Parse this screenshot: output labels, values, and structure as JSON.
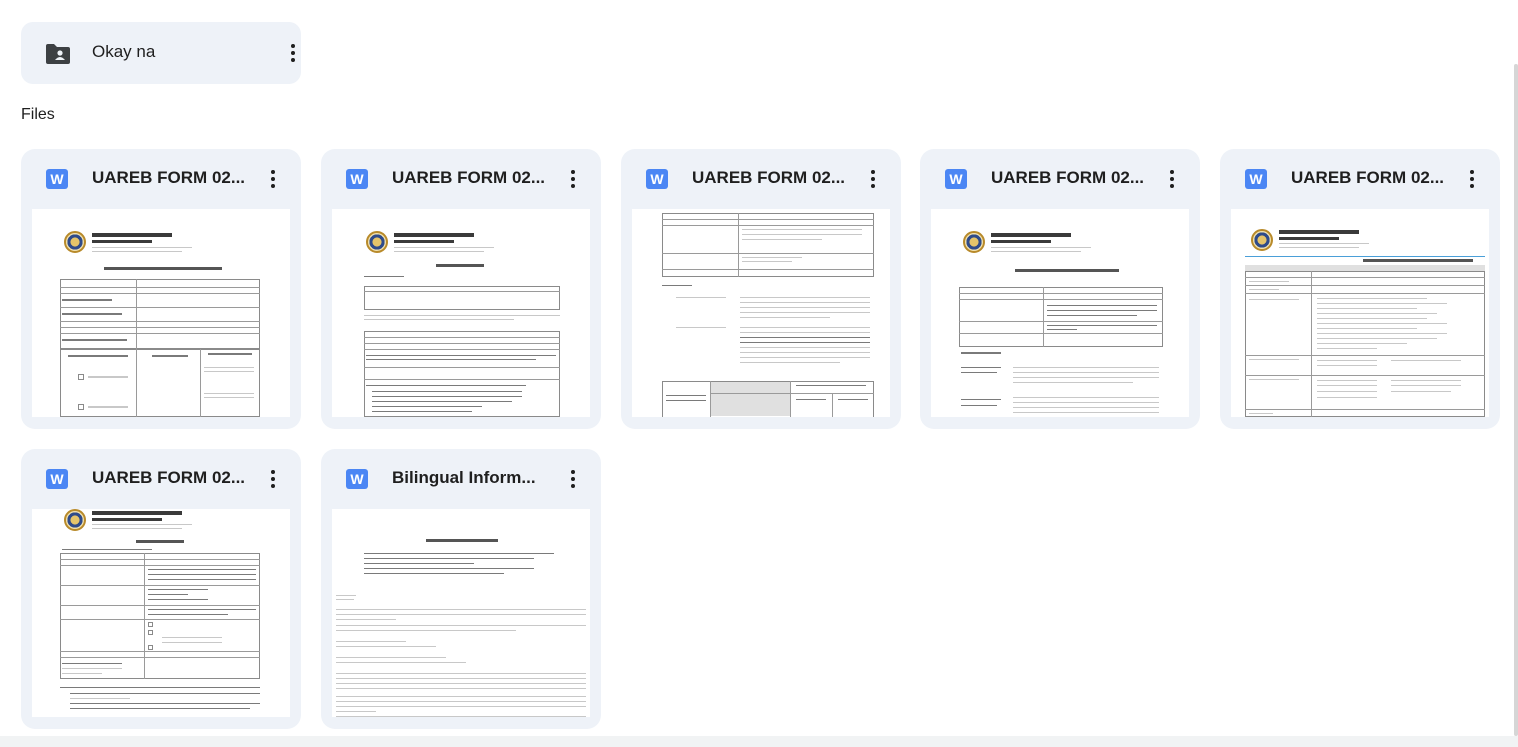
{
  "folder": {
    "name": "Okay na",
    "icon": "shared-folder-icon"
  },
  "section_title": "Files",
  "files": [
    {
      "name": "UAREB FORM 02...",
      "type": "word",
      "icon_letter": "W",
      "thumb_title": "Initial Action on the Protocol Submission"
    },
    {
      "name": "UAREB FORM 02...",
      "type": "word",
      "icon_letter": "W",
      "thumb_title": "Notice of Review"
    },
    {
      "name": "UAREB FORM 02...",
      "type": "word",
      "icon_letter": "W",
      "thumb_title": ""
    },
    {
      "name": "UAREB FORM 02...",
      "type": "word",
      "icon_letter": "W",
      "thumb_title": "Study Protocol Assessment Form"
    },
    {
      "name": "UAREB FORM 02...",
      "type": "word",
      "icon_letter": "W",
      "thumb_title": "Registration and Application Form"
    },
    {
      "name": "UAREB FORM 02...",
      "type": "word",
      "icon_letter": "W",
      "thumb_title": "Review Checklist"
    },
    {
      "name": "Bilingual Inform...",
      "type": "word",
      "icon_letter": "W",
      "thumb_title": "Bilingual Informed Consent"
    }
  ],
  "colors": {
    "card_bg": "#eef2f8",
    "word_blue": "#4b86f4"
  }
}
